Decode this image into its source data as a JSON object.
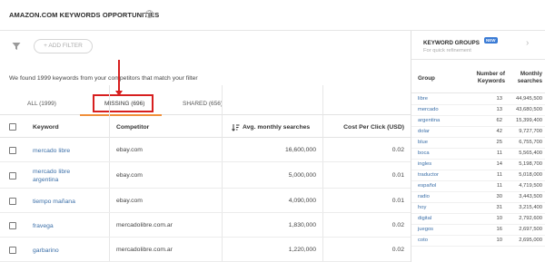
{
  "header": {
    "title": "AMAZON.COM KEYWORDS OPPORTUNITIES",
    "help_icon": "question-circle-icon"
  },
  "filters": {
    "add_filter_label": "+ ADD FILTER",
    "filter_icon": "funnel-icon"
  },
  "summary": {
    "found_text": "We found 1999 keywords from your competitors that match your filter"
  },
  "tabs": [
    {
      "label": "ALL (1999)"
    },
    {
      "label": "MISSING (696)",
      "active": true
    },
    {
      "label": "SHARED (656)"
    }
  ],
  "table": {
    "columns": {
      "keyword": "Keyword",
      "competitor": "Competitor",
      "avg": "Avg. monthly searches",
      "cpc": "Cost Per Click (USD)"
    },
    "rows": [
      {
        "keyword": "mercado libre",
        "competitor": "ebay.com",
        "avg": "16,600,000",
        "cpc": "0.02"
      },
      {
        "keyword": "mercado libre argentina",
        "competitor": "ebay.com",
        "avg": "5,000,000",
        "cpc": "0.01"
      },
      {
        "keyword": "tiempo mañana",
        "competitor": "ebay.com",
        "avg": "4,090,000",
        "cpc": "0.01"
      },
      {
        "keyword": "fravega",
        "competitor": "mercadolibre.com.ar",
        "avg": "1,830,000",
        "cpc": "0.02"
      },
      {
        "keyword": "garbarino",
        "competitor": "mercadolibre.com.ar",
        "avg": "1,220,000",
        "cpc": "0.02"
      }
    ]
  },
  "keyword_groups": {
    "title": "KEYWORD GROUPS",
    "badge": "NEW",
    "subtitle": "For quick refinement",
    "columns": {
      "group": "Group",
      "number": "Number of Keywords",
      "monthly": "Monthly searches"
    },
    "rows": [
      {
        "name": "libre",
        "count": "13",
        "monthly": "44,945,500"
      },
      {
        "name": "mercado",
        "count": "13",
        "monthly": "43,680,500"
      },
      {
        "name": "argentina",
        "count": "62",
        "monthly": "15,399,400"
      },
      {
        "name": "dolar",
        "count": "42",
        "monthly": "9,727,700"
      },
      {
        "name": "blue",
        "count": "25",
        "monthly": "6,755,700"
      },
      {
        "name": "boca",
        "count": "11",
        "monthly": "5,565,400"
      },
      {
        "name": "ingles",
        "count": "14",
        "monthly": "5,198,700"
      },
      {
        "name": "traductor",
        "count": "11",
        "monthly": "5,018,000"
      },
      {
        "name": "español",
        "count": "11",
        "monthly": "4,719,500"
      },
      {
        "name": "radio",
        "count": "30",
        "monthly": "3,443,500"
      },
      {
        "name": "hoy",
        "count": "31",
        "monthly": "3,215,400"
      },
      {
        "name": "digital",
        "count": "10",
        "monthly": "2,792,600"
      },
      {
        "name": "juegos",
        "count": "16",
        "monthly": "2,697,500"
      },
      {
        "name": "coto",
        "count": "10",
        "monthly": "2,695,000"
      }
    ]
  },
  "colors": {
    "accent_tab": "#f08f3a",
    "highlight": "#d71f1f",
    "link": "#3b6fa8"
  }
}
